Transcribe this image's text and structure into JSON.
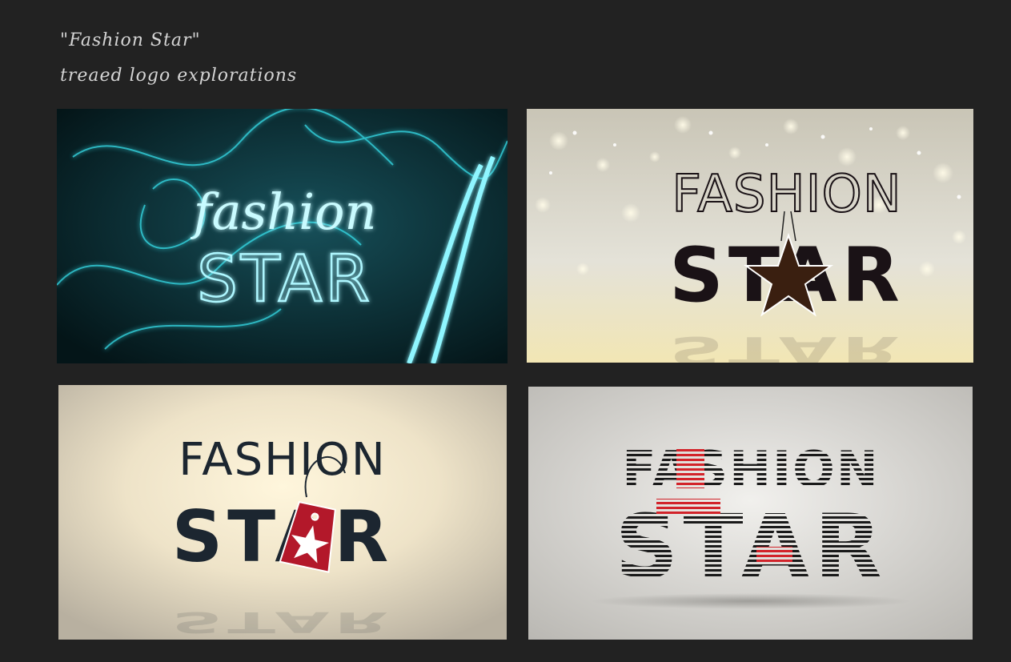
{
  "header": {
    "title_line1": "\"Fashion Star\"",
    "title_line2": "treaed logo explorations"
  },
  "panels": [
    {
      "id": "neon",
      "word1": "fashion",
      "word2": "STAR",
      "colors": {
        "bg": "#0b2a30",
        "glow": "#39e6f2"
      }
    },
    {
      "id": "bokeh",
      "word1": "FASHION",
      "word2": "STAR",
      "colors": {
        "bg": "#d9d6c8",
        "text": "#1a1216",
        "star": "#3a1f10"
      }
    },
    {
      "id": "tag",
      "word1": "FASHION",
      "word2": "STAR",
      "colors": {
        "bg": "#e9dfcb",
        "text": "#1c2630",
        "tag": "#b3182a"
      }
    },
    {
      "id": "stripe",
      "word1": "FASHION",
      "word2": "STAR",
      "colors": {
        "bg": "#e4e3df",
        "text": "#1a1a1a",
        "accent": "#d2232a"
      }
    }
  ]
}
